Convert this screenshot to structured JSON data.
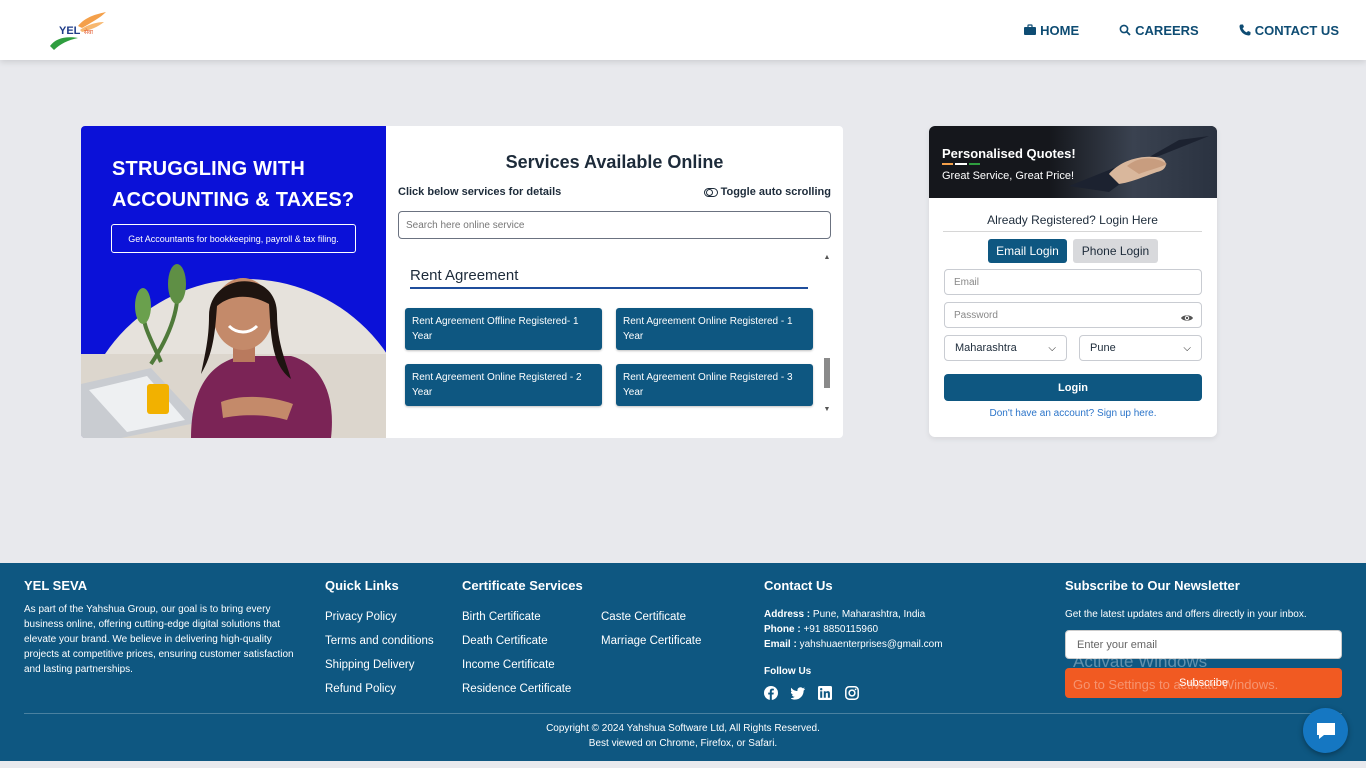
{
  "header": {
    "logo_text": "YEL",
    "logo_sub": "सेवा",
    "nav": [
      {
        "label": "HOME",
        "icon": "briefcase-icon"
      },
      {
        "label": "CAREERS",
        "icon": "search-icon"
      },
      {
        "label": "CONTACT US",
        "icon": "phone-icon"
      }
    ]
  },
  "banner": {
    "title_line1": "STRUGGLING WITH",
    "title_line2": "ACCOUNTING & TAXES?",
    "subtitle": "Get Accountants for bookkeeping, payroll & tax filing."
  },
  "services": {
    "title": "Services Available Online",
    "hint": "Click below services for details",
    "toggle_label": "Toggle auto scrolling",
    "search_placeholder": "Search here online service",
    "category": "Rent Agreement",
    "items": [
      "Rent Agreement Offline Registered- 1 Year",
      "Rent Agreement Online Registered - 1 Year",
      "Rent Agreement Online Registered - 2 Year",
      "Rent Agreement Online Registered - 3 Year"
    ]
  },
  "login": {
    "promo_title": "Personalised Quotes!",
    "promo_sub": "Great Service, Great Price!",
    "heading": "Already Registered? Login Here",
    "tab_email": "Email Login",
    "tab_phone": "Phone Login",
    "email_placeholder": "Email",
    "password_placeholder": "Password",
    "state": "Maharashtra",
    "city": "Pune",
    "button": "Login",
    "signup": "Don't have an account? Sign up here."
  },
  "footer": {
    "brand": "YEL SEVA",
    "about": "As part of the Yahshua Group, our goal is to bring every business online, offering cutting-edge digital solutions that elevate your brand. We believe in delivering high-quality projects at competitive prices, ensuring customer satisfaction and lasting partnerships.",
    "quick_links_title": "Quick Links",
    "quick_links": [
      "Privacy Policy",
      "Terms and conditions",
      "Shipping Delivery",
      "Refund Policy"
    ],
    "cert_title": "Certificate Services",
    "cert_col1": [
      "Birth Certificate",
      "Death Certificate",
      "Income Certificate",
      "Residence Certificate"
    ],
    "cert_col2": [
      "Caste Certificate",
      "Marriage Certificate"
    ],
    "contact_title": "Contact Us",
    "address_label": "Address :",
    "address": "Pune, Maharashtra, India",
    "phone_label": "Phone :",
    "phone": "+91 8850115960",
    "email_label": "Email :",
    "email": "yahshuaenterprises@gmail.com",
    "follow": "Follow Us",
    "socials": [
      "facebook-icon",
      "twitter-icon",
      "linkedin-icon",
      "instagram-icon"
    ],
    "newsletter_title": "Subscribe to Our Newsletter",
    "newsletter_desc": "Get the latest updates and offers directly in your inbox.",
    "newsletter_placeholder": "Enter your email",
    "subscribe": "Subscribe",
    "copyright": "Copyright © 2024 Yahshua Software Ltd, All Rights Reserved.",
    "best_viewed": "Best viewed on Chrome, Firefox, or Safari."
  },
  "watermark": {
    "line1": "Activate Windows",
    "line2": "Go to Settings to activate Windows."
  },
  "colors": {
    "primary": "#0e5781",
    "banner_blue": "#0b11d8",
    "subscribe": "#f15a22",
    "background": "#e8e9ed"
  }
}
